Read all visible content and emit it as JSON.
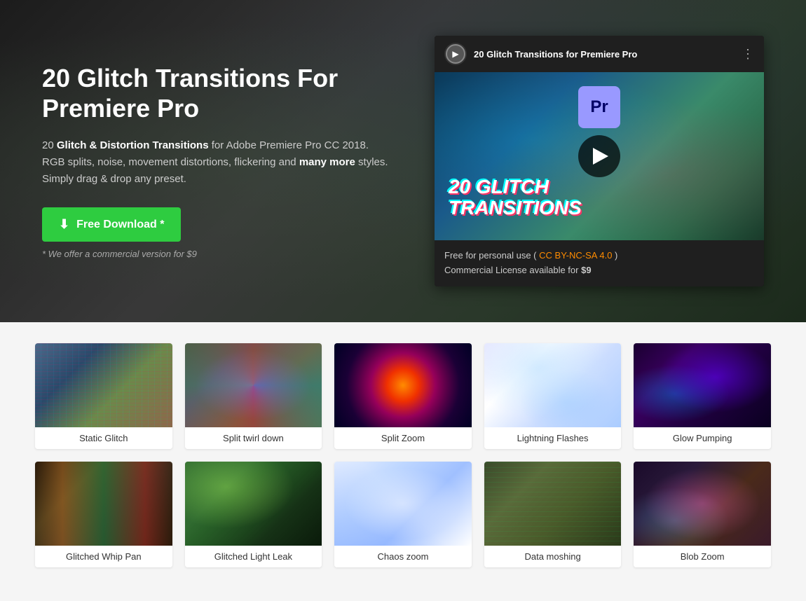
{
  "hero": {
    "title": "20 Glitch Transitions For Premiere Pro",
    "description_part1": "20 ",
    "description_bold1": "Glitch & Distortion Transitions",
    "description_part2": " for Adobe Premiere Pro CC 2018. RGB splits, noise, movement distortions, flickering and ",
    "description_bold2": "many more",
    "description_part3": " styles. Simply drag & drop any preset.",
    "download_button": "Free Download *",
    "commercial_note": "* We offer a commercial version for $9",
    "video_title": "20 Glitch Transitions for Premiere Pro",
    "video_thumbnail_text_line1": "20 GLITCH",
    "video_thumbnail_text_line2": "TRANSITIONS",
    "pr_logo": "Pr",
    "license_text1": "Free for personal use (",
    "license_link": "CC BY-NC-SA 4.0",
    "license_text2": ")",
    "license_text3": "Commercial License available for ",
    "license_price": "$9"
  },
  "grid": {
    "row1": [
      {
        "label": "Static Glitch",
        "thumb_class": "thumb-static-glitch"
      },
      {
        "label": "Split twirl down",
        "thumb_class": "thumb-split-twirl"
      },
      {
        "label": "Split Zoom",
        "thumb_class": "thumb-split-zoom"
      },
      {
        "label": "Lightning Flashes",
        "thumb_class": "thumb-lightning"
      },
      {
        "label": "Glow Pumping",
        "thumb_class": "thumb-glow-pumping"
      }
    ],
    "row2": [
      {
        "label": "Glitched Whip Pan",
        "thumb_class": "thumb-whip-pan"
      },
      {
        "label": "Glitched Light Leak",
        "thumb_class": "thumb-light-leak"
      },
      {
        "label": "Chaos zoom",
        "thumb_class": "thumb-chaos-zoom"
      },
      {
        "label": "Data moshing",
        "thumb_class": "thumb-data-moshing"
      },
      {
        "label": "Blob Zoom",
        "thumb_class": "thumb-blob-zoom"
      }
    ]
  },
  "colors": {
    "download_btn": "#2ecc40",
    "cc_link": "#ff8c00"
  }
}
